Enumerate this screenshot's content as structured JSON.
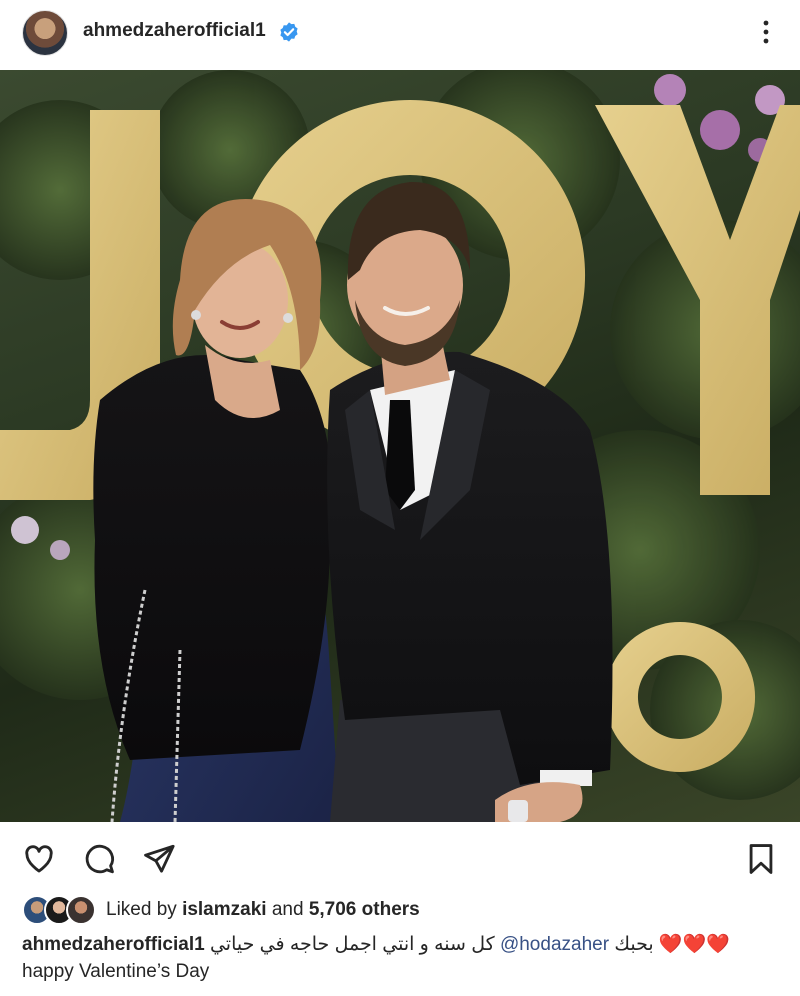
{
  "post_header": {
    "username": "ahmedzaherofficial1",
    "verified": true,
    "avatar_icon": "profile-avatar",
    "more_icon": "more-vertical-icon"
  },
  "photo": {
    "backdrop_sign_text": "JOY",
    "accent_gold": "#d8bf7a"
  },
  "actions": {
    "like_icon": "heart-outline-icon",
    "comment_icon": "comment-icon",
    "share_icon": "send-icon",
    "save_icon": "bookmark-icon"
  },
  "likes": {
    "prefix": "Liked by",
    "user": "islamzaki",
    "conjunction": "and",
    "count_text": "5,706 others"
  },
  "caption": {
    "username": "ahmedzaherofficial1",
    "arabic_text": "كل سنه و انتي اجمل حاجه في حياتي",
    "mention": "@hodazaher",
    "arabic_love": "بحبك",
    "hearts": "❤️❤️❤️",
    "line2": "happy Valentine’s Day"
  },
  "colors": {
    "text": "#262626",
    "mention": "#385185",
    "verified_blue": "#3897f0",
    "heart_red": "#d8203a"
  }
}
